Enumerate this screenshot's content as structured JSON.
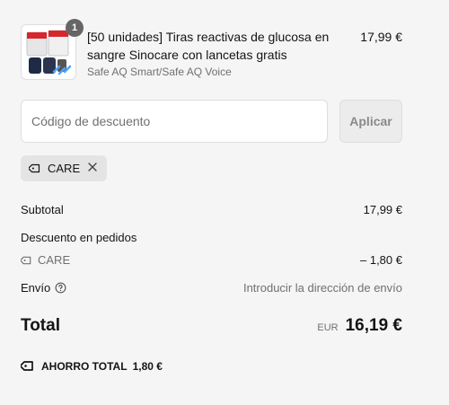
{
  "cart_item": {
    "quantity": "1",
    "name": "[50 unidades] Tiras reactivas de glucosa en sangre Sinocare con lancetas gratis",
    "variant": "Safe AQ Smart/Safe AQ Voice",
    "price": "17,99 €"
  },
  "discount": {
    "placeholder": "Código de descuento",
    "value": "",
    "apply_label": "Aplicar",
    "applied_code": "CARE"
  },
  "summary": {
    "subtotal_label": "Subtotal",
    "subtotal_value": "17,99 €",
    "order_discount_label": "Descuento en pedidos",
    "discount_code": "CARE",
    "discount_value": "– 1,80 €",
    "shipping_label": "Envío",
    "shipping_value": "Introducir la dirección de envío",
    "total_label": "Total",
    "currency": "EUR",
    "total_value": "16,19 €",
    "savings_label": "AHORRO TOTAL",
    "savings_value": "1,80 €"
  },
  "icons": {
    "tag": "tag-icon",
    "close": "close-icon",
    "help": "help-circle-icon"
  }
}
